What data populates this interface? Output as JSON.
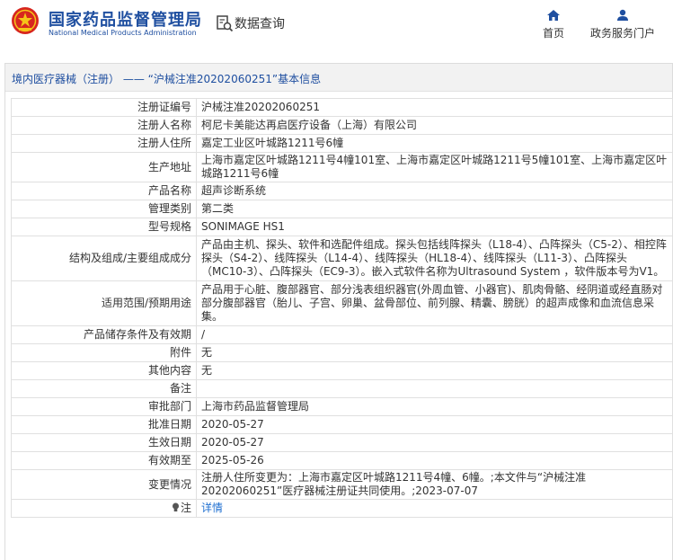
{
  "header": {
    "org_name_cn": "国家药品监督管理局",
    "org_name_en": "National Medical Products Administration",
    "data_query_label": "数据查询",
    "nav": [
      {
        "label": "首页",
        "icon": "home-icon"
      },
      {
        "label": "政务服务门户",
        "icon": "user-icon"
      }
    ]
  },
  "breadcrumb": {
    "category": "境内医疗器械（注册）",
    "separator": "——",
    "title": "“沪械注准20202060251”基本信息"
  },
  "colors": {
    "brand_blue": "#1f4fa0",
    "link_blue": "#1f6fd0",
    "logo_red": "#d7261e"
  },
  "record": [
    {
      "label": "注册证编号",
      "value": "沪械注准20202060251"
    },
    {
      "label": "注册人名称",
      "value": "柯尼卡美能达再启医疗设备（上海）有限公司"
    },
    {
      "label": "注册人住所",
      "value": "嘉定工业区叶城路1211号6幢"
    },
    {
      "label": "生产地址",
      "value": "上海市嘉定区叶城路1211号4幢101室、上海市嘉定区叶城路1211号5幢101室、上海市嘉定区叶城路1211号6幢"
    },
    {
      "label": "产品名称",
      "value": "超声诊断系统"
    },
    {
      "label": "管理类别",
      "value": "第二类"
    },
    {
      "label": "型号规格",
      "value": "SONIMAGE HS1"
    },
    {
      "label": "结构及组成/主要组成成分",
      "value": "产品由主机、探头、软件和选配件组成。探头包括线阵探头（L18-4）、凸阵探头（C5-2）、相控阵探头（S4-2）、线阵探头（L14-4）、线阵探头（HL18-4）、线阵探头（L11-3）、凸阵探头（MC10-3）、凸阵探头（EC9-3）。嵌入式软件名称为Ultrasound System ，软件版本号为V1。"
    },
    {
      "label": "适用范围/预期用途",
      "value": "产品用于心脏、腹部器官、部分浅表组织器官(外周血管、小器官)、肌肉骨骼、经阴道或经直肠对部分腹部器官（胎儿、子宫、卵巢、盆骨部位、前列腺、精囊、膀胱）的超声成像和血流信息采集。"
    },
    {
      "label": "产品储存条件及有效期",
      "value": "/"
    },
    {
      "label": "附件",
      "value": "无"
    },
    {
      "label": "其他内容",
      "value": "无"
    },
    {
      "label": "备注",
      "value": ""
    },
    {
      "label": "审批部门",
      "value": "上海市药品监督管理局"
    },
    {
      "label": "批准日期",
      "value": "2020-05-27"
    },
    {
      "label": "生效日期",
      "value": "2020-05-27"
    },
    {
      "label": "有效期至",
      "value": "2025-05-26"
    },
    {
      "label": "变更情况",
      "value": "注册人住所变更为：上海市嘉定区叶城路1211号4幢、6幢。;本文件与“沪械注准20202060251”医疗器械注册证共同使用。;2023-07-07"
    }
  ],
  "note": {
    "label": "注",
    "link_text": "详情",
    "icon": "lightbulb-icon"
  }
}
